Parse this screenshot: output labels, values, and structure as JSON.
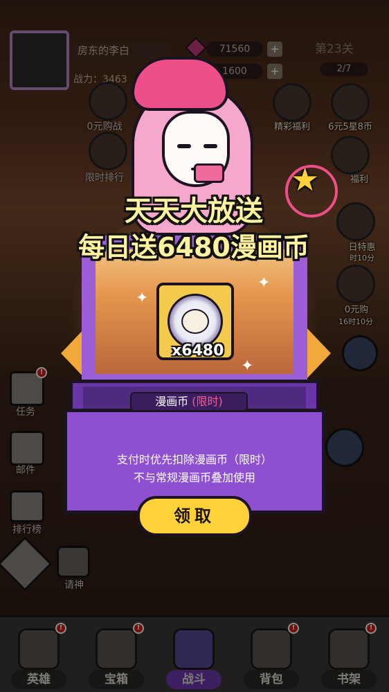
{
  "hud": {
    "player_name": "房东的李白",
    "power_label": "战力：3463",
    "currency_1": "71560",
    "currency_2": "1600",
    "stage": "第23关",
    "progress": "2/7"
  },
  "right_menu": [
    {
      "label": "精彩福利"
    },
    {
      "label": "6元5星8币"
    },
    {
      "label": "福利"
    },
    {
      "label": "日特惠"
    },
    {
      "label": "时10分"
    },
    {
      "label": "0元购"
    },
    {
      "label": "16时10分"
    }
  ],
  "left_menu": [
    {
      "label": "0元购战"
    },
    {
      "label": "限时排行"
    },
    {
      "label": "任务"
    },
    {
      "label": "邮件"
    },
    {
      "label": "排行榜"
    },
    {
      "label": "请神"
    }
  ],
  "popup": {
    "title_line1": "天天大放送",
    "title_line2": "每日送6480漫画币",
    "item_quantity": "x6480",
    "item_name": "漫画币",
    "item_tag": "(限时)",
    "desc_line1": "支付时优先扣除漫画币（限时）",
    "desc_line2": "不与常规漫画币叠加使用",
    "claim_label": "领取"
  },
  "bottom_nav": [
    {
      "label": "英雄",
      "active": false
    },
    {
      "label": "宝箱",
      "active": false
    },
    {
      "label": "战斗",
      "active": true
    },
    {
      "label": "背包",
      "active": false
    },
    {
      "label": "书架",
      "active": false
    }
  ],
  "colors": {
    "accent_purple": "#8e4fd0",
    "title_yellow": "#fff2a0",
    "button_yellow": "#ffd23a",
    "tag_pink": "#ff5a8a",
    "badge_red": "#d01a1a"
  },
  "icons": {
    "coin": "manga-coin-icon",
    "star": "star-icon",
    "sparkle": "sparkle-icon"
  }
}
